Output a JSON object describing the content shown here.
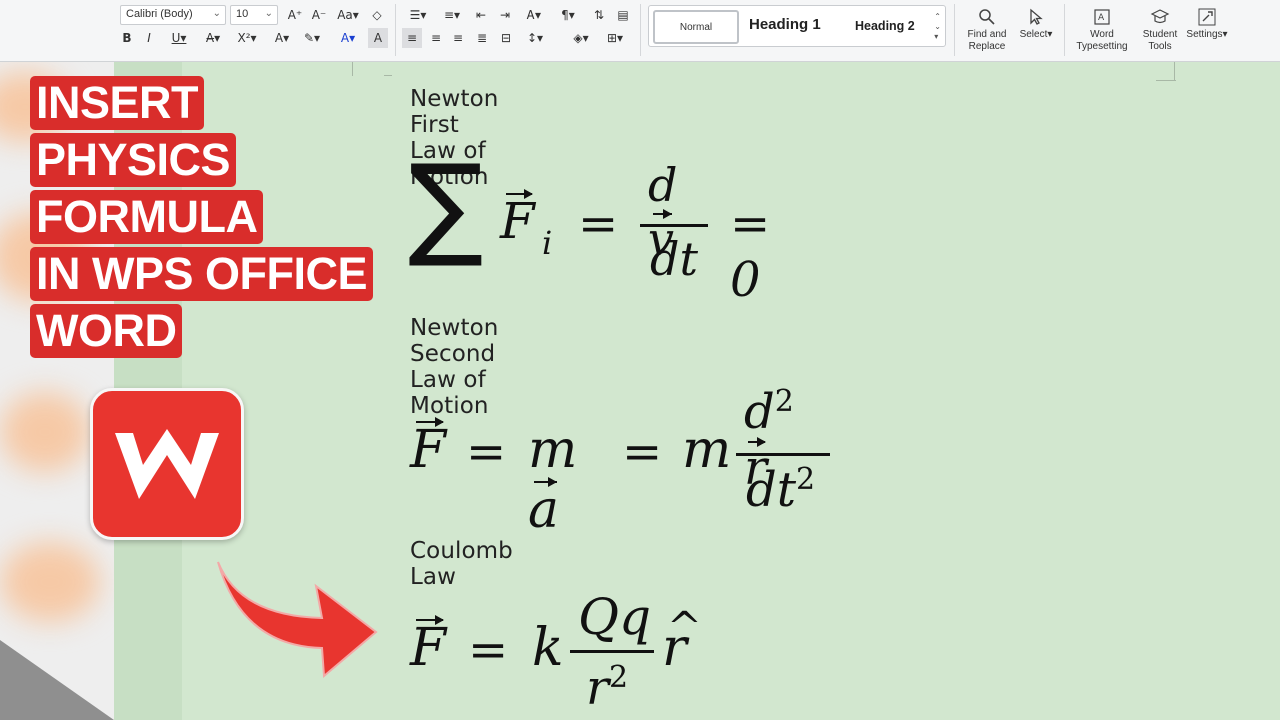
{
  "ribbon": {
    "font_name": "Calibri (Body)",
    "font_size": "10",
    "styles": {
      "normal": "Normal",
      "heading1": "Heading 1",
      "heading2": "Heading 2"
    },
    "find_replace": "Find and Replace",
    "select": "Select",
    "word_typesetting": "Word Typesetting",
    "student_tools": "Student Tools",
    "settings": "Settings"
  },
  "promo": {
    "lines": [
      "INSERT",
      "PHYSICS",
      "FORMULA",
      "IN WPS OFFICE",
      "WORD"
    ],
    "brand_color": "#e8352f"
  },
  "document": {
    "sections": [
      {
        "heading": "Newton First Law of Motion",
        "formula": "∑ F⃗_i = dv⃗/dt = 0"
      },
      {
        "heading": "Newton Second Law of Motion",
        "formula": "F⃗ = ma⃗ = m d²r⃗/dt²"
      },
      {
        "heading": "Coulomb Law",
        "formula": "F⃗ = k Qq/r² r̂"
      }
    ]
  },
  "colors": {
    "page_bg": "#d2e7cf",
    "accent_red": "#d92d2b"
  }
}
